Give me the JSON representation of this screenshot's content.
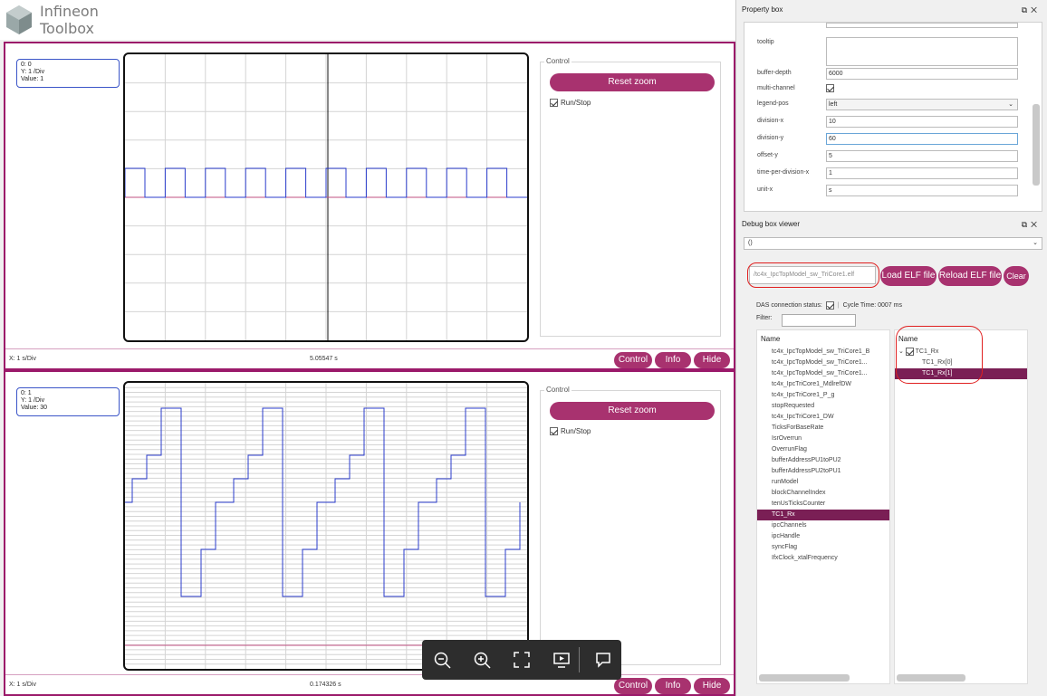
{
  "app": {
    "title_line1": "Infineon",
    "title_line2": "Toolbox"
  },
  "scopes": [
    {
      "info_lines": [
        "0: 0",
        "Y: 1 /Div",
        "Value: 1"
      ],
      "control_legend": "Control",
      "reset_label": "Reset zoom",
      "run_stop_label": "Run/Stop",
      "x_div": "X: 1 s/Div",
      "time": "5.05547 s",
      "buttons": {
        "control": "Control",
        "info": "Info",
        "hide": "Hide"
      }
    },
    {
      "info_lines": [
        "0: 1",
        "Y: 1 /Div",
        "Value: 30"
      ],
      "control_legend": "Control",
      "reset_label": "Reset zoom",
      "run_stop_label": "Run/Stop",
      "x_div": "X: 1 s/Div",
      "time": "0.174326 s",
      "buttons": {
        "control": "Control",
        "info": "Info",
        "hide": "Hide"
      }
    }
  ],
  "zoom_toolbar": [
    "zoom-out-icon",
    "zoom-in-icon",
    "fit-screen-icon",
    "present-icon",
    "comment-icon"
  ],
  "property_box": {
    "title": "Property box",
    "rows": [
      {
        "label": "tooltip",
        "value": ""
      },
      {
        "label": "buffer-depth",
        "value": "6000"
      },
      {
        "label": "multi-channel",
        "value": "checked"
      },
      {
        "label": "legend-pos",
        "value": "left"
      },
      {
        "label": "division-x",
        "value": "10"
      },
      {
        "label": "division-y",
        "value": "60"
      },
      {
        "label": "offset-y",
        "value": "5"
      },
      {
        "label": "time-per-division-x",
        "value": "1"
      },
      {
        "label": "unit-x",
        "value": "s"
      }
    ]
  },
  "debug_box": {
    "title": "Debug box viewer",
    "select_value": "()",
    "elf_path": "/tc4x_IpcTopModel_sw_TriCore1.elf",
    "load_label": "Load ELF file",
    "reload_label": "Reload ELF file",
    "clear_label": "Clear",
    "das_label": "DAS connection status:",
    "cycle_label": "Cycle Time: 0007 ms",
    "filter_label": "Filter:",
    "left_header": "Name",
    "right_header": "Name",
    "left_items": [
      "tc4x_IpcTopModel_sw_TriCore1_B",
      "tc4x_IpcTopModel_sw_TriCore1...",
      "tc4x_IpcTopModel_sw_TriCore1...",
      "tc4x_IpcTriCore1_MdlrefDW",
      "tc4x_IpcTriCore1_P_g",
      "stopRequested",
      "tc4x_IpcTriCore1_DW",
      "TicksForBaseRate",
      "IsrOverrun",
      "OverrunFlag",
      "bufferAddressPU1toPU2",
      "bufferAddressPU2toPU1",
      "runModel",
      "blockChannelIndex",
      "tenUsTicksCounter",
      "TC1_Rx",
      "ipcChannels",
      "ipcHandle",
      "syncFlag",
      "IfxClock_xtalFrequency"
    ],
    "right_items": [
      "TC1_Rx",
      "TC1_Rx[0]",
      "TC1_Rx[1]"
    ]
  },
  "colors": {
    "accent": "#a8326f",
    "selected": "#7a1f55",
    "trace": "#2b3ccc"
  }
}
